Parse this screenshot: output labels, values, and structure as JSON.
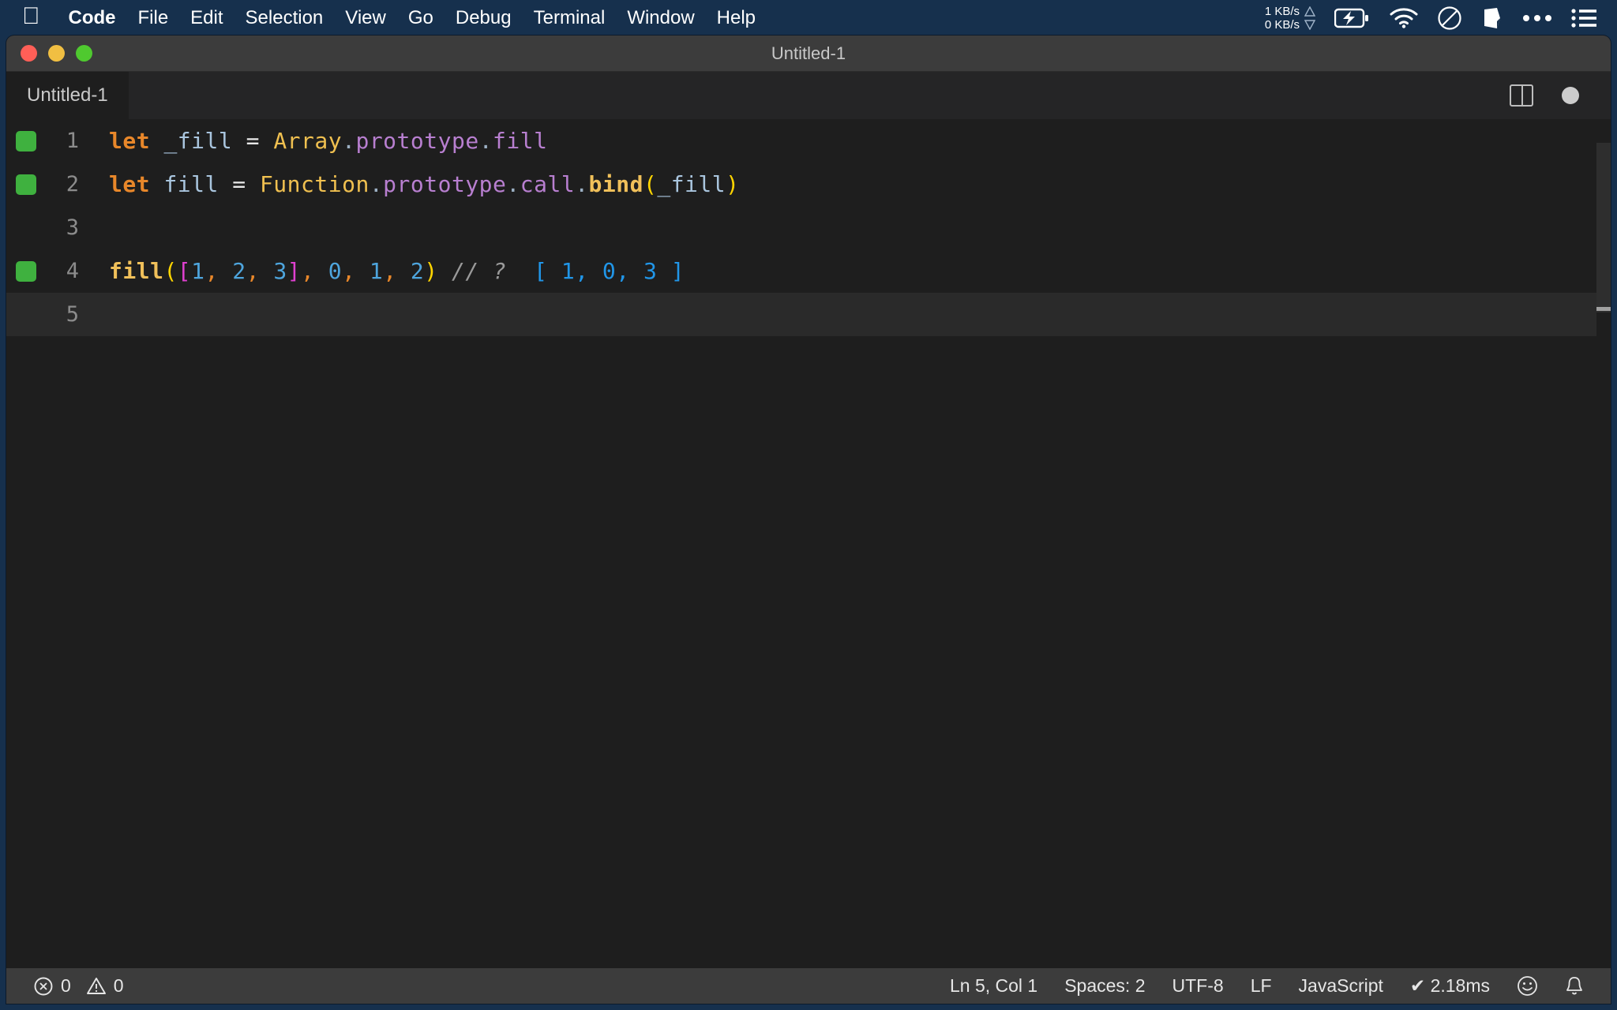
{
  "menubar": {
    "apple_icon": "apple-logo-icon",
    "items": [
      {
        "label": "Code",
        "bold": true
      },
      {
        "label": "File",
        "bold": false
      },
      {
        "label": "Edit",
        "bold": false
      },
      {
        "label": "Selection",
        "bold": false
      },
      {
        "label": "View",
        "bold": false
      },
      {
        "label": "Go",
        "bold": false
      },
      {
        "label": "Debug",
        "bold": false
      },
      {
        "label": "Terminal",
        "bold": false
      },
      {
        "label": "Window",
        "bold": false
      },
      {
        "label": "Help",
        "bold": false
      }
    ],
    "network": {
      "upload": "1 KB/s",
      "download": "0 KB/s"
    },
    "status_icons": [
      "battery-charging-icon",
      "wifi-icon",
      "do-not-disturb-icon",
      "dropbox-icon",
      "ellipsis-icon",
      "list-menu-icon"
    ]
  },
  "window": {
    "title": "Untitled-1",
    "traffic_lights": [
      "close-button",
      "minimize-button",
      "maximize-button"
    ]
  },
  "tabs": {
    "items": [
      {
        "label": "Untitled-1",
        "active": true,
        "dirty": true
      }
    ],
    "split_editor_label": "split-editor-icon",
    "dirty_indicator_label": "unsaved-changes-dot"
  },
  "editor": {
    "language": "JavaScript",
    "lines": [
      {
        "number": "1",
        "marker": true,
        "active": false,
        "tokens": [
          {
            "t": "let",
            "c": "t-kw"
          },
          {
            "t": " ",
            "c": "t-op"
          },
          {
            "t": "_fill",
            "c": "t-var"
          },
          {
            "t": " ",
            "c": "t-op"
          },
          {
            "t": "=",
            "c": "t-op"
          },
          {
            "t": " ",
            "c": "t-op"
          },
          {
            "t": "Array",
            "c": "t-class"
          },
          {
            "t": ".",
            "c": "t-dot"
          },
          {
            "t": "prototype",
            "c": "t-prop"
          },
          {
            "t": ".",
            "c": "t-dot"
          },
          {
            "t": "fill",
            "c": "t-prop"
          }
        ]
      },
      {
        "number": "2",
        "marker": true,
        "active": false,
        "tokens": [
          {
            "t": "let",
            "c": "t-kw"
          },
          {
            "t": " ",
            "c": "t-op"
          },
          {
            "t": "fill",
            "c": "t-var"
          },
          {
            "t": " ",
            "c": "t-op"
          },
          {
            "t": "=",
            "c": "t-op"
          },
          {
            "t": " ",
            "c": "t-op"
          },
          {
            "t": "Function",
            "c": "t-class"
          },
          {
            "t": ".",
            "c": "t-dot"
          },
          {
            "t": "prototype",
            "c": "t-prop"
          },
          {
            "t": ".",
            "c": "t-dot"
          },
          {
            "t": "call",
            "c": "t-prop"
          },
          {
            "t": ".",
            "c": "t-dot"
          },
          {
            "t": "bind",
            "c": "t-fn"
          },
          {
            "t": "(",
            "c": "t-paren"
          },
          {
            "t": "_fill",
            "c": "t-var"
          },
          {
            "t": ")",
            "c": "t-paren"
          }
        ]
      },
      {
        "number": "3",
        "marker": false,
        "active": false,
        "tokens": []
      },
      {
        "number": "4",
        "marker": true,
        "active": false,
        "tokens": [
          {
            "t": "fill",
            "c": "t-fn"
          },
          {
            "t": "(",
            "c": "t-paren"
          },
          {
            "t": "[",
            "c": "t-bracket"
          },
          {
            "t": "1",
            "c": "t-num"
          },
          {
            "t": ",",
            "c": "t-comma"
          },
          {
            "t": " ",
            "c": "t-op"
          },
          {
            "t": "2",
            "c": "t-num"
          },
          {
            "t": ",",
            "c": "t-comma"
          },
          {
            "t": " ",
            "c": "t-op"
          },
          {
            "t": "3",
            "c": "t-num"
          },
          {
            "t": "]",
            "c": "t-bracket"
          },
          {
            "t": ",",
            "c": "t-comma"
          },
          {
            "t": " ",
            "c": "t-op"
          },
          {
            "t": "0",
            "c": "t-num"
          },
          {
            "t": ",",
            "c": "t-comma"
          },
          {
            "t": " ",
            "c": "t-op"
          },
          {
            "t": "1",
            "c": "t-num"
          },
          {
            "t": ",",
            "c": "t-comma"
          },
          {
            "t": " ",
            "c": "t-op"
          },
          {
            "t": "2",
            "c": "t-num"
          },
          {
            "t": ")",
            "c": "t-paren"
          },
          {
            "t": " ",
            "c": "t-op"
          },
          {
            "t": "// ?",
            "c": "t-comment"
          },
          {
            "t": "  ",
            "c": "t-op"
          },
          {
            "t": "[ 1, 0, 3 ]",
            "c": "t-result"
          }
        ]
      },
      {
        "number": "5",
        "marker": false,
        "active": true,
        "tokens": []
      }
    ]
  },
  "statusbar": {
    "errors": "0",
    "warnings": "0",
    "error_icon": "error-circle-icon",
    "warning_icon": "warning-triangle-icon",
    "cursor_position": "Ln 5, Col 1",
    "indentation": "Spaces: 2",
    "encoding": "UTF-8",
    "eol": "LF",
    "language_mode": "JavaScript",
    "runtime": "✔ 2.18ms",
    "feedback_icon": "smiley-icon",
    "bell_icon": "notification-bell-icon"
  },
  "colors": {
    "menubar_bg": "#16304d",
    "titlebar_bg": "#3c3c3c",
    "editor_bg": "#1e1e1e",
    "tabbar_bg": "#252526",
    "marker_green": "#3fb13f",
    "accent_yellow": "#ffd500"
  }
}
